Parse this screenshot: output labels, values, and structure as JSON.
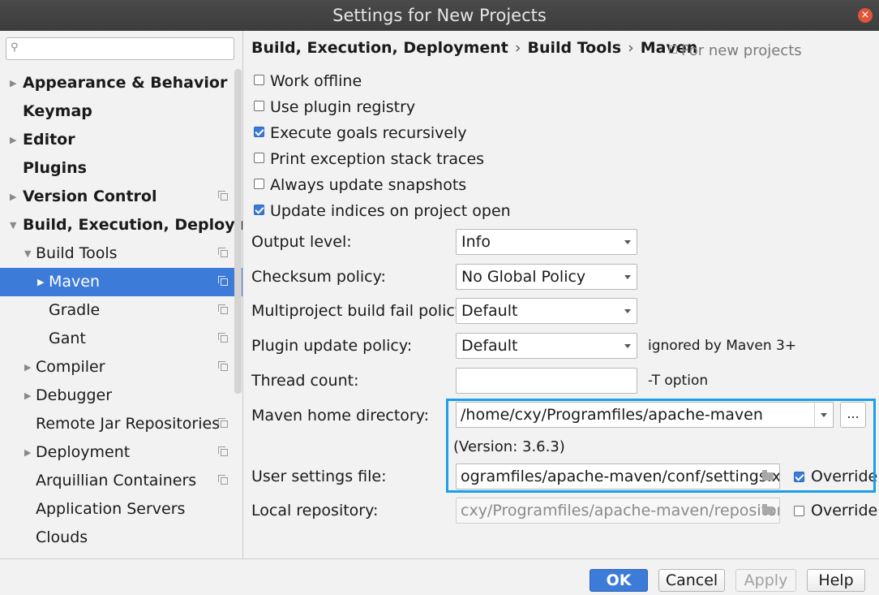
{
  "window": {
    "title": "Settings for New Projects",
    "close_glyph": "×"
  },
  "search": {
    "icon": "search-icon",
    "value": ""
  },
  "tree": [
    {
      "label": "Appearance & Behavior",
      "bold": true,
      "arrow": "right",
      "indent": 0,
      "copy": false
    },
    {
      "label": "Keymap",
      "bold": true,
      "arrow": "none",
      "indent": 0,
      "copy": false
    },
    {
      "label": "Editor",
      "bold": true,
      "arrow": "right",
      "indent": 0,
      "copy": false
    },
    {
      "label": "Plugins",
      "bold": true,
      "arrow": "none",
      "indent": 0,
      "copy": false
    },
    {
      "label": "Version Control",
      "bold": true,
      "arrow": "right",
      "indent": 0,
      "copy": true
    },
    {
      "label": "Build, Execution, Deploymen",
      "bold": true,
      "arrow": "down",
      "indent": 0,
      "copy": false
    },
    {
      "label": "Build Tools",
      "bold": false,
      "arrow": "down",
      "indent": 1,
      "copy": true
    },
    {
      "label": "Maven",
      "bold": false,
      "arrow": "right",
      "indent": 2,
      "copy": true,
      "selected": true
    },
    {
      "label": "Gradle",
      "bold": false,
      "arrow": "none",
      "indent": 2,
      "copy": true
    },
    {
      "label": "Gant",
      "bold": false,
      "arrow": "none",
      "indent": 2,
      "copy": true
    },
    {
      "label": "Compiler",
      "bold": false,
      "arrow": "right",
      "indent": 1,
      "copy": true
    },
    {
      "label": "Debugger",
      "bold": false,
      "arrow": "right",
      "indent": 1,
      "copy": false
    },
    {
      "label": "Remote Jar Repositories",
      "bold": false,
      "arrow": "none",
      "indent": 1,
      "copy": true
    },
    {
      "label": "Deployment",
      "bold": false,
      "arrow": "right",
      "indent": 1,
      "copy": true
    },
    {
      "label": "Arquillian Containers",
      "bold": false,
      "arrow": "none",
      "indent": 1,
      "copy": true
    },
    {
      "label": "Application Servers",
      "bold": false,
      "arrow": "none",
      "indent": 1,
      "copy": false
    },
    {
      "label": "Clouds",
      "bold": false,
      "arrow": "none",
      "indent": 1,
      "copy": false
    }
  ],
  "breadcrumb": {
    "part1": "Build, Execution, Deployment",
    "sep1": "›",
    "part2": "Build Tools",
    "sep2": "›",
    "part3": "Maven"
  },
  "scope_note": "For new projects",
  "checkboxes": [
    {
      "label": "Work offline",
      "checked": false
    },
    {
      "label": "Use plugin registry",
      "checked": false
    },
    {
      "label": "Execute goals recursively",
      "checked": true
    },
    {
      "label": "Print exception stack traces",
      "checked": false
    },
    {
      "label": "Always update snapshots",
      "checked": false
    },
    {
      "label": "Update indices on project open",
      "checked": true
    }
  ],
  "form": {
    "output_level": {
      "label": "Output level:",
      "value": "Info"
    },
    "checksum_policy": {
      "label": "Checksum policy:",
      "value": "No Global Policy"
    },
    "multiproject_fail": {
      "label": "Multiproject build fail policy:",
      "value": "Default"
    },
    "plugin_update": {
      "label": "Plugin update policy:",
      "value": "Default",
      "hint": "ignored by Maven 3+"
    },
    "thread_count": {
      "label": "Thread count:",
      "value": "",
      "hint": "-T option"
    },
    "maven_home": {
      "label": "Maven home directory:",
      "value": "/home/cxy/Programfiles/apache-maven",
      "browse_label": "...",
      "version": "(Version: 3.6.3)"
    },
    "user_settings": {
      "label": "User settings file:",
      "value": "ogramfiles/apache-maven/conf/settings.xml",
      "override_label": "Override",
      "override_checked": true
    },
    "local_repo": {
      "label": "Local repository:",
      "value": "cxy/Programfiles/apache-maven/repository",
      "override_label": "Override",
      "override_checked": false
    }
  },
  "buttons": {
    "ok": "OK",
    "cancel": "Cancel",
    "apply": "Apply",
    "help": "Help"
  },
  "colors": {
    "accent": "#3d7bd9",
    "highlight_box": "#1a9fe8"
  }
}
